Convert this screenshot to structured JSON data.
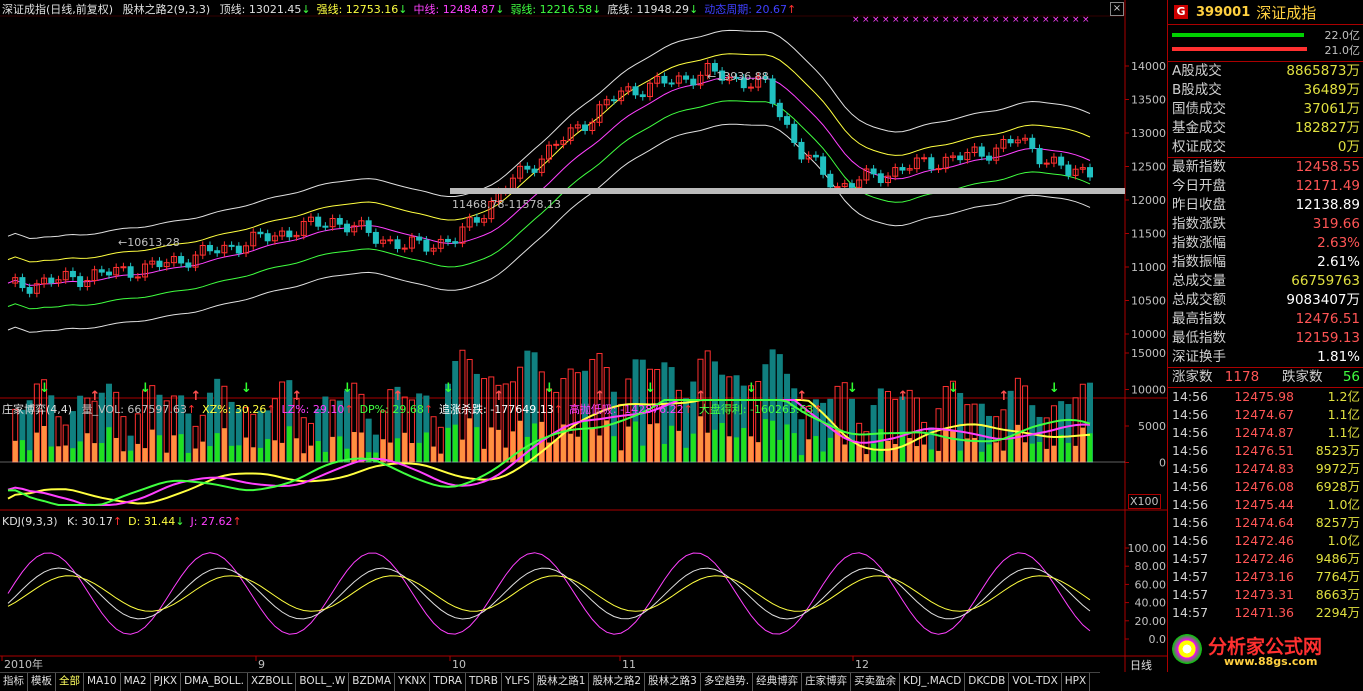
{
  "main_panel": {
    "title": "深证成指(日线,前复权)",
    "indicator": "股林之路2(9,3,3)",
    "items": [
      {
        "label": "顶线: 13021.45",
        "arrow": "↓",
        "color": "#e0e0e0"
      },
      {
        "label": "强线: 12753.16",
        "arrow": "↓",
        "color": "#ffff40"
      },
      {
        "label": "中线: 12484.87",
        "arrow": "↓",
        "color": "#ff40ff"
      },
      {
        "label": "弱线: 12216.58",
        "arrow": "↓",
        "color": "#40ff40"
      },
      {
        "label": "底线: 11948.29",
        "arrow": "↓",
        "color": "#e0e0e0"
      },
      {
        "label": "动态周期: 20.67",
        "arrow": "↑",
        "color": "#4040ff"
      }
    ],
    "y_ticks": [
      "14000",
      "13500",
      "13000",
      "12500",
      "12000",
      "11500",
      "11000",
      "10500",
      "10000"
    ],
    "annotations": {
      "high": "13936.88",
      "low": "10613.28",
      "band": "11468.78-11578.13"
    }
  },
  "vol_panel": {
    "title": "庄家博弈(4,4)",
    "items": [
      {
        "label": "量_VOL: 667597.63",
        "arrow": "↑",
        "color": "#c0c0c0"
      },
      {
        "label": "XZ%: 30.26",
        "arrow": "↑",
        "color": "#ffff40"
      },
      {
        "label": "LZ%: 29.10",
        "arrow": "↑",
        "color": "#ff40ff"
      },
      {
        "label": "DP%: 29.68",
        "arrow": "↑",
        "color": "#40ff40"
      },
      {
        "label": "追涨杀跌: -177649.13",
        "arrow": "↑",
        "color": "#ffffff"
      },
      {
        "label": "高抛低吸: -142876.22",
        "arrow": "↑",
        "color": "#ff40ff"
      },
      {
        "label": "大盘得利: -160263.63",
        "arrow": "↑",
        "color": "#40ff40"
      }
    ],
    "y_ticks": [
      "15000",
      "10000",
      "5000",
      "0"
    ],
    "scale_label": "X100"
  },
  "kdj_panel": {
    "title": "KDJ(9,3,3)",
    "items": [
      {
        "label": "K: 30.17",
        "arrow": "↑",
        "color": "#e0e0e0"
      },
      {
        "label": "D: 31.44",
        "arrow": "↓",
        "color": "#ffff40"
      },
      {
        "label": "J: 27.62",
        "arrow": "↑",
        "color": "#ff40ff"
      }
    ],
    "y_ticks": [
      "100.00",
      "80.00",
      "60.00",
      "40.00",
      "20.00",
      "0.0"
    ]
  },
  "x_axis": {
    "labels": [
      "2010年",
      "9",
      "10",
      "11",
      "12"
    ],
    "period": "日线"
  },
  "side": {
    "code": "399001",
    "name": "深证成指",
    "badge": "G",
    "bar_top": "22.0亿",
    "bar_bot": "21.0亿",
    "volume_rows": [
      {
        "label": "A股成交",
        "value": "8865873万"
      },
      {
        "label": "B股成交",
        "value": "36489万"
      },
      {
        "label": "国债成交",
        "value": "37061万"
      },
      {
        "label": "基金成交",
        "value": "182827万"
      },
      {
        "label": "权证成交",
        "value": "0万"
      }
    ],
    "quote_rows": [
      {
        "label": "最新指数",
        "value": "12458.55",
        "color": "#ff5555"
      },
      {
        "label": "今日开盘",
        "value": "12171.49",
        "color": "#ff5555"
      },
      {
        "label": "昨日收盘",
        "value": "12138.89",
        "color": "#ffffff"
      },
      {
        "label": "指数涨跌",
        "value": "319.66",
        "color": "#ff5555"
      },
      {
        "label": "指数涨幅",
        "value": "2.63%",
        "color": "#ff5555"
      },
      {
        "label": "指数振幅",
        "value": "2.61%",
        "color": "#ffffff"
      },
      {
        "label": "总成交量",
        "value": "66759763",
        "color": "#e0e040"
      },
      {
        "label": "总成交额",
        "value": "9083407万",
        "color": "#ffffff"
      },
      {
        "label": "最高指数",
        "value": "12476.51",
        "color": "#ff5555"
      },
      {
        "label": "最低指数",
        "value": "12159.13",
        "color": "#ff5555"
      },
      {
        "label": "深证换手",
        "value": "1.81%",
        "color": "#ffffff"
      }
    ],
    "updown": {
      "up_label": "涨家数",
      "up": "1178",
      "down_label": "跌家数",
      "down": "56"
    },
    "ticks": [
      {
        "t": "14:56",
        "p": "12475.98",
        "v": "1.2亿"
      },
      {
        "t": "14:56",
        "p": "12474.67",
        "v": "1.1亿"
      },
      {
        "t": "14:56",
        "p": "12474.87",
        "v": "1.1亿"
      },
      {
        "t": "14:56",
        "p": "12476.51",
        "v": "8523万"
      },
      {
        "t": "14:56",
        "p": "12474.83",
        "v": "9972万"
      },
      {
        "t": "14:56",
        "p": "12476.08",
        "v": "6928万"
      },
      {
        "t": "14:56",
        "p": "12475.44",
        "v": "1.0亿"
      },
      {
        "t": "14:56",
        "p": "12474.64",
        "v": "8257万"
      },
      {
        "t": "14:56",
        "p": "12472.46",
        "v": "1.0亿"
      },
      {
        "t": "14:57",
        "p": "12472.46",
        "v": "9486万"
      },
      {
        "t": "14:57",
        "p": "12473.16",
        "v": "7764万"
      },
      {
        "t": "14:57",
        "p": "12473.31",
        "v": "8663万"
      },
      {
        "t": "14:57",
        "p": "12471.36",
        "v": "2294万"
      }
    ]
  },
  "tabs": [
    "指标",
    "模板",
    "全部",
    "MA10",
    "MA2",
    "PJKX",
    "DMA_BOLL.",
    "XZBOLL",
    "BOLL_.W",
    "BZDMA",
    "YKNX",
    "TDRA",
    "TDRB",
    "YLFS",
    "股林之路1",
    "股林之路2",
    "股林之路3",
    "多空趋势.",
    "经典博弈",
    "庄家博弈",
    "买卖盈余",
    "KDJ_.MACD",
    "DKCDB",
    "VOL-TDX",
    "HPX"
  ],
  "active_tab": "全部",
  "watermark": {
    "cn": "分析家公式网",
    "url": "www.88gs.com"
  }
}
